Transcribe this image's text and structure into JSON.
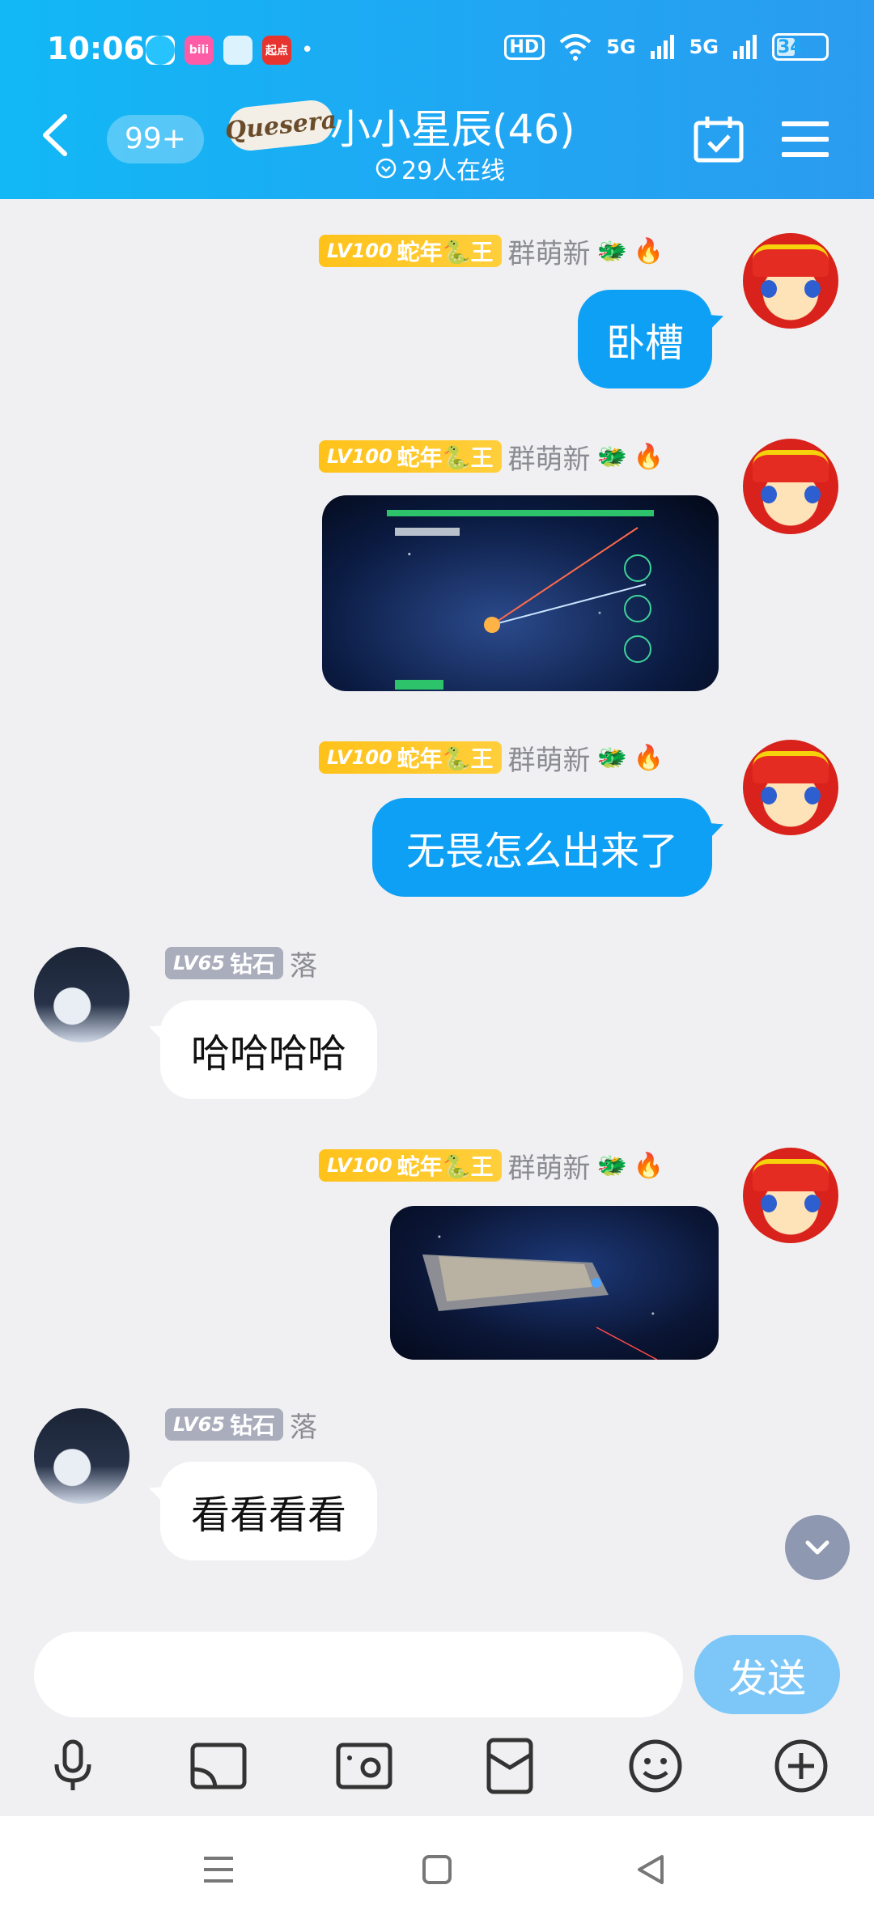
{
  "status_bar": {
    "time": "10:06",
    "apps": [
      "du",
      "bili",
      "",
      "起点",
      ""
    ],
    "network_hd": "HD",
    "network_5g_1": "5G",
    "network_5g_2": "5G",
    "battery": "34",
    "battery_level": 0.34
  },
  "header": {
    "unread_count": "99+",
    "group_logo_text": "Quesera",
    "group_title": "小小星辰(46)",
    "online_text": "29人在线"
  },
  "messages": [
    {
      "side": "right",
      "level": "LV100",
      "title": "蛇年🐍王",
      "name": "群萌新",
      "icons": [
        "dragon-icon",
        "fire-icon"
      ],
      "type": "text",
      "text": "卧槽"
    },
    {
      "side": "right",
      "level": "LV100",
      "title": "蛇年🐍王",
      "name": "群萌新",
      "icons": [
        "dragon-icon",
        "fire-icon"
      ],
      "type": "image",
      "image": "space-battle-screenshot"
    },
    {
      "side": "right",
      "level": "LV100",
      "title": "蛇年🐍王",
      "name": "群萌新",
      "icons": [
        "dragon-icon",
        "fire-icon"
      ],
      "type": "text",
      "text": "无畏怎么出来了"
    },
    {
      "side": "left",
      "level": "LV65",
      "title": "钻石",
      "name": "落",
      "type": "text",
      "text": "哈哈哈哈"
    },
    {
      "side": "right",
      "level": "LV100",
      "title": "蛇年🐍王",
      "name": "群萌新",
      "icons": [
        "dragon-icon",
        "fire-icon"
      ],
      "type": "image",
      "image": "space-ship-screenshot"
    },
    {
      "side": "left",
      "level": "LV65",
      "title": "钻石",
      "name": "落",
      "type": "text",
      "text": "看看看看"
    }
  ],
  "input": {
    "placeholder": "",
    "value": "",
    "send_label": "发送"
  },
  "toolbar": [
    "microphone-icon",
    "screen-cast-icon",
    "photo-icon",
    "red-packet-icon",
    "emoji-icon",
    "plus-icon"
  ],
  "nav": [
    "menu-icon",
    "home-icon",
    "back-icon"
  ],
  "colors": {
    "header": "#1fa7f3",
    "my_bubble": "#0ea0f5",
    "send_button": "#7cc7f7",
    "gold_badge": "#ffc21a",
    "gray_badge": "#a9adbc"
  }
}
